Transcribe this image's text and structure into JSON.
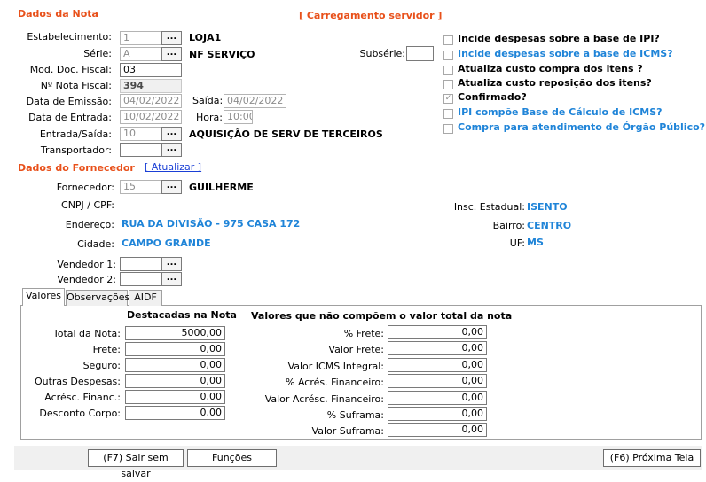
{
  "nota": {
    "section_title": "Dados da Nota",
    "loading_text": "[ Carregamento servidor ]",
    "estabelecimento": {
      "label": "Estabelecimento:",
      "code": "1",
      "name": "LOJA1"
    },
    "serie": {
      "label": "Série:",
      "code": "A",
      "name": "NF SERVIÇO"
    },
    "subserie": {
      "label": "Subsérie:",
      "value": ""
    },
    "mod_doc": {
      "label": "Mod. Doc. Fiscal:",
      "value": "03"
    },
    "nota_fiscal": {
      "label": "Nº Nota Fiscal:",
      "value": "394"
    },
    "data_emissao": {
      "label": "Data de Emissão:",
      "value": "04/02/2022"
    },
    "saida": {
      "label": "Saída:",
      "value": "04/02/2022"
    },
    "data_entrada": {
      "label": "Data de Entrada:",
      "value": "10/02/2022"
    },
    "hora": {
      "label": "Hora:",
      "value": "10:00"
    },
    "entrada_saida": {
      "label": "Entrada/Saída:",
      "code": "10",
      "name": "AQUISIÇÃO DE SERV DE TERCEIROS"
    },
    "transportador": {
      "label": "Transportador:",
      "code": ""
    },
    "dots": "..."
  },
  "options": [
    {
      "label": "Incide despesas sobre a base de IPI?",
      "checked": false,
      "style": "normal"
    },
    {
      "label": "Incide despesas sobre a base de ICMS?",
      "checked": false,
      "style": "blue"
    },
    {
      "label": "Atualiza custo compra dos itens ?",
      "checked": false,
      "style": "normal"
    },
    {
      "label": "Atualiza custo reposição dos itens?",
      "checked": false,
      "style": "normal"
    },
    {
      "label": "Confirmado?",
      "checked": true,
      "style": "normal"
    },
    {
      "label": "IPI compõe Base de Cálculo de ICMS?",
      "checked": false,
      "style": "blue"
    },
    {
      "label": "Compra para atendimento de Órgão Público?",
      "checked": false,
      "style": "blue"
    }
  ],
  "fornecedor": {
    "section_title": "Dados do Fornecedor",
    "update_link": "[ Atualizar ]",
    "fornecedor": {
      "label": "Fornecedor:",
      "code": "15",
      "name": "GUILHERME"
    },
    "cnpj": {
      "label": "CNPJ / CPF:",
      "value": ""
    },
    "endereco": {
      "label": "Endereço:",
      "value": "RUA DA DIVISÃO - 975  CASA 172"
    },
    "cidade": {
      "label": "Cidade:",
      "value": "CAMPO GRANDE"
    },
    "insc_estadual": {
      "label": "Insc. Estadual:",
      "value": "ISENTO"
    },
    "bairro": {
      "label": "Bairro:",
      "value": "CENTRO"
    },
    "uf": {
      "label": "UF:",
      "value": "MS"
    },
    "vendedor1": {
      "label": "Vendedor 1:",
      "value": ""
    },
    "vendedor2": {
      "label": "Vendedor 2:",
      "value": ""
    }
  },
  "tabs": [
    {
      "label": "Valores",
      "active": true
    },
    {
      "label": "Observações",
      "active": false
    },
    {
      "label": "AIDF",
      "active": false
    }
  ],
  "valores": {
    "left_header": "Destacadas na Nota",
    "right_header": "Valores que não compõem o valor total da nota",
    "left": [
      {
        "label": "Total da Nota:",
        "value": "5000,00"
      },
      {
        "label": "Frete:",
        "value": "0,00"
      },
      {
        "label": "Seguro:",
        "value": "0,00"
      },
      {
        "label": "Outras Despesas:",
        "value": "0,00"
      },
      {
        "label": "Acrésc. Financ.:",
        "value": "0,00"
      },
      {
        "label": "Desconto Corpo:",
        "value": "0,00"
      }
    ],
    "right": [
      {
        "label": "% Frete:",
        "value": "0,00"
      },
      {
        "label": "Valor Frete:",
        "value": "0,00"
      },
      {
        "label": "Valor ICMS Integral:",
        "value": "0,00"
      },
      {
        "label": "% Acrés. Financeiro:",
        "value": "0,00"
      },
      {
        "label": "Valor Acrésc. Financeiro:",
        "value": "0,00"
      },
      {
        "label": "% Suframa:",
        "value": "0,00"
      },
      {
        "label": "Valor Suframa:",
        "value": "0,00"
      }
    ]
  },
  "buttons": {
    "exit": "(F7) Sair sem salvar",
    "functions": "Funções",
    "next": "(F6) Próxima Tela"
  },
  "colors": {
    "section": "#e8501a",
    "link_blue": "#1f84d8"
  }
}
